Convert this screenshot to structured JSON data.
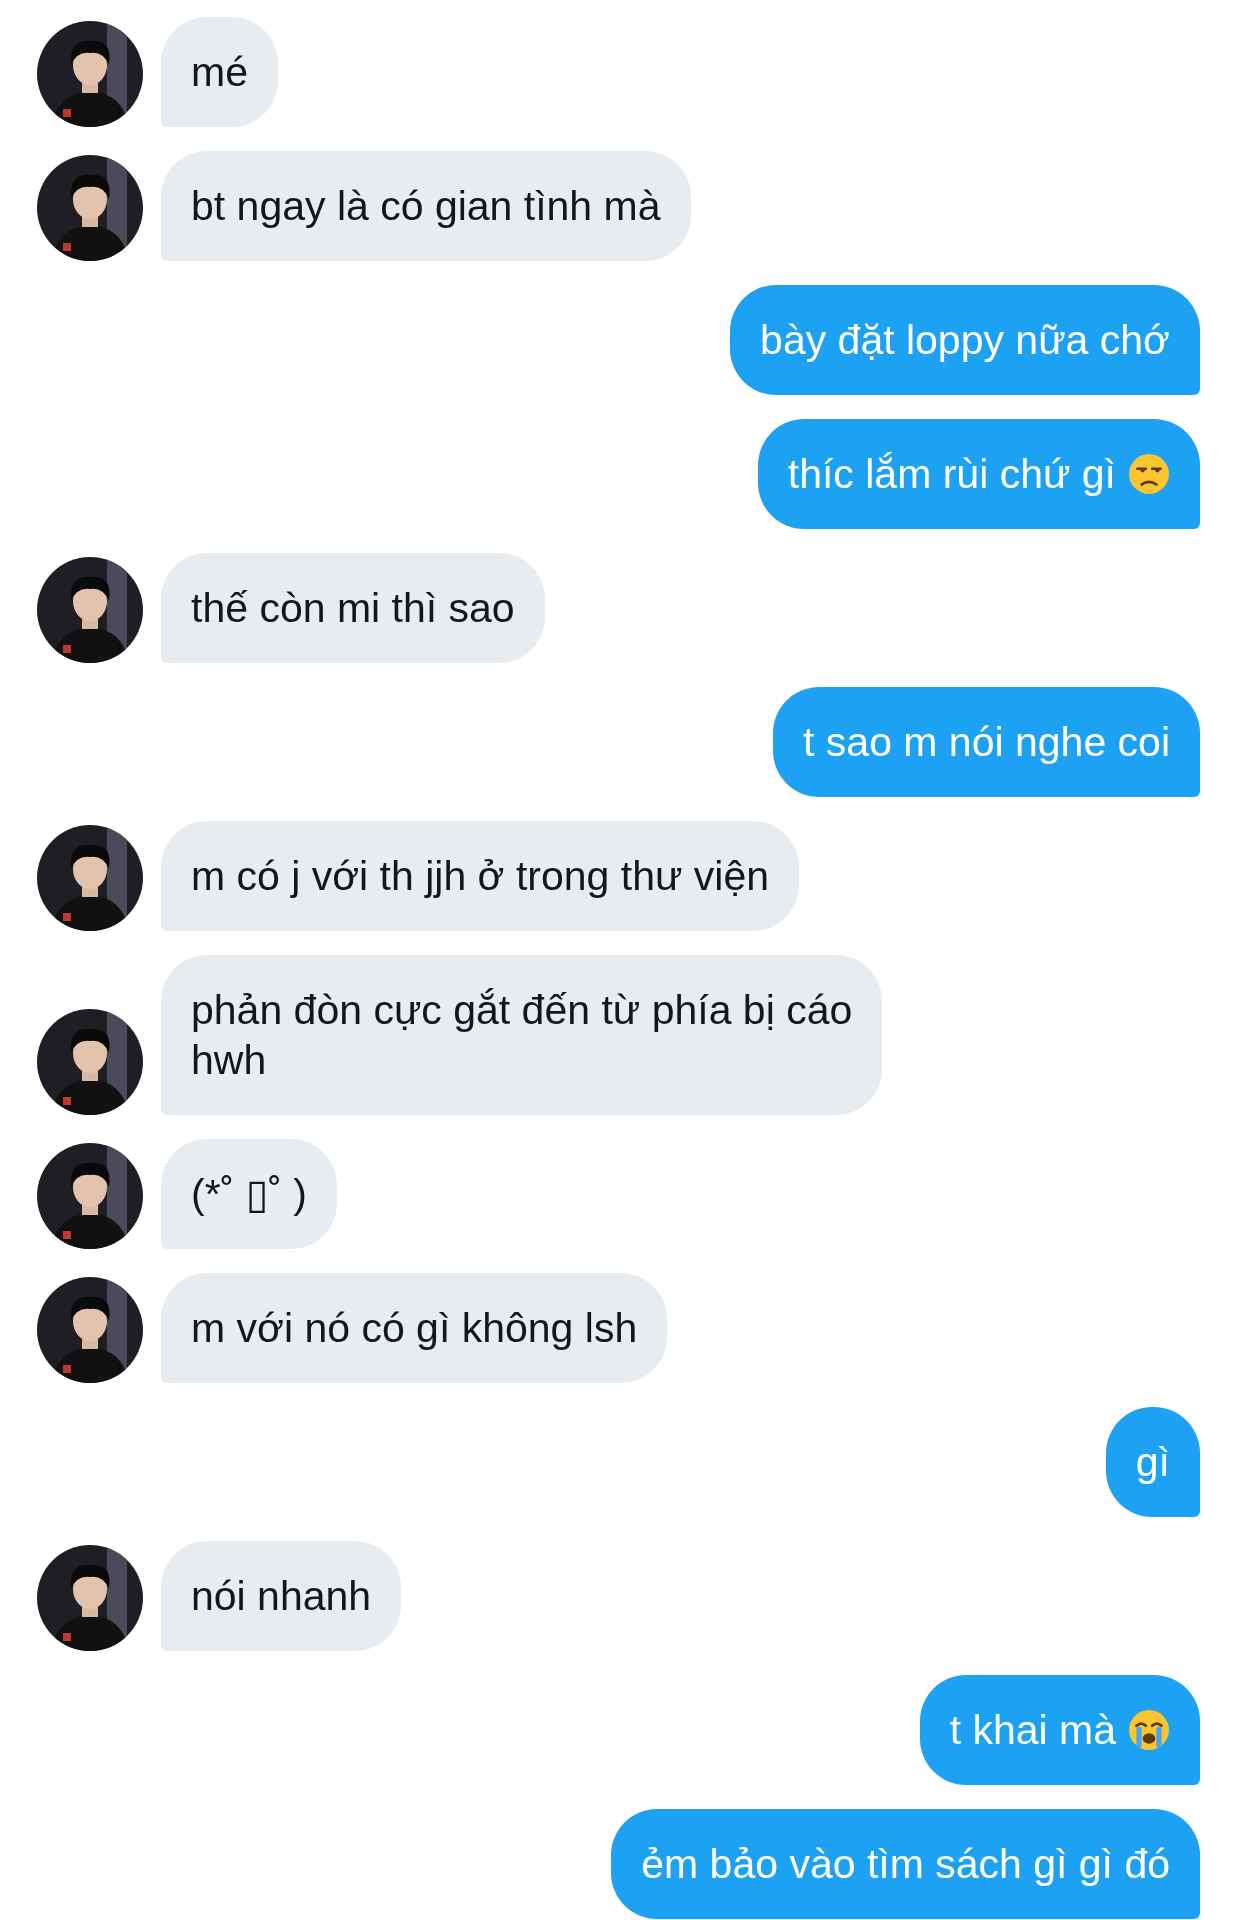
{
  "messages": [
    {
      "kind": "received",
      "text": "mé"
    },
    {
      "kind": "received",
      "text": "bt ngay là có gian tình mà"
    },
    {
      "kind": "sent",
      "text": "bày đặt loppy nữa chớ"
    },
    {
      "kind": "sent",
      "text": "thíc lắm rùi chứ gì",
      "emoji": {
        "kind": "unamused"
      }
    },
    {
      "kind": "received",
      "text": "thế còn mi thì sao"
    },
    {
      "kind": "sent",
      "text": "t sao m nói nghe coi"
    },
    {
      "kind": "received",
      "text": "m có j với th jjh ở trong thư viện"
    },
    {
      "kind": "received",
      "text": "phản đòn cực gắt đến từ phía bị cáo\nhwh"
    },
    {
      "kind": "received",
      "text": "(*˚ ▯˚ )"
    },
    {
      "kind": "received",
      "text": "m với nó có gì không lsh"
    },
    {
      "kind": "sent",
      "text": "gì"
    },
    {
      "kind": "received",
      "text": "nói nhanh"
    },
    {
      "kind": "sent",
      "text": "t khai mà",
      "emoji": {
        "kind": "crying"
      }
    },
    {
      "kind": "sent",
      "text": "ẻm bảo vào tìm sách gì gì đó"
    }
  ]
}
